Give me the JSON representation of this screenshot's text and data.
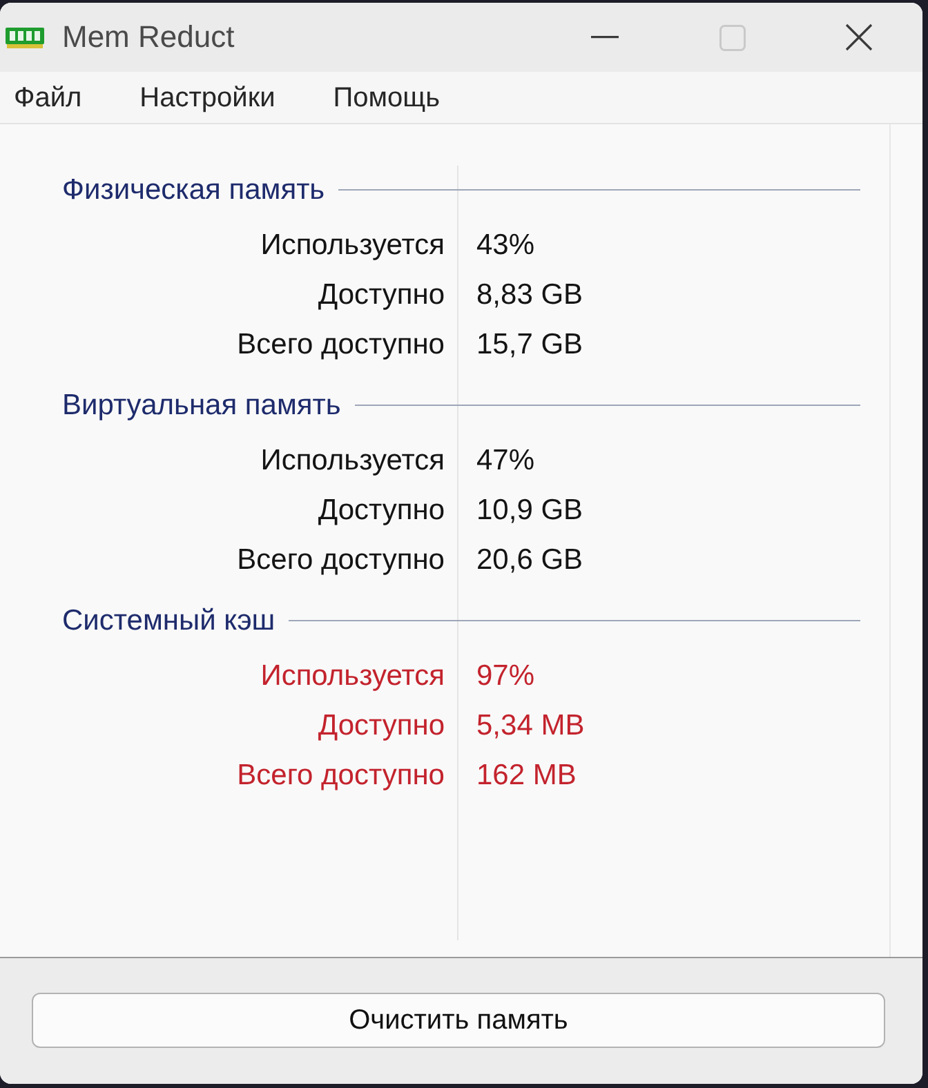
{
  "window": {
    "title": "Mem Reduct",
    "controls": [
      {
        "kind": "minimize",
        "disabled": false
      },
      {
        "kind": "maximize",
        "disabled": true
      },
      {
        "kind": "close",
        "disabled": false
      }
    ]
  },
  "menu": [
    "Файл",
    "Настройки",
    "Помощь"
  ],
  "groups": [
    {
      "title": "Физическая память",
      "rows": [
        {
          "label": "Используется",
          "value": "43%",
          "warning": false
        },
        {
          "label": "Доступно",
          "value": "8,83 GB",
          "warning": false
        },
        {
          "label": "Всего доступно",
          "value": "15,7 GB",
          "warning": false
        }
      ]
    },
    {
      "title": "Виртуальная память",
      "rows": [
        {
          "label": "Используется",
          "value": "47%",
          "warning": false
        },
        {
          "label": "Доступно",
          "value": "10,9 GB",
          "warning": false
        },
        {
          "label": "Всего доступно",
          "value": "20,6 GB",
          "warning": false
        }
      ]
    },
    {
      "title": "Системный кэш",
      "rows": [
        {
          "label": "Используется",
          "value": "97%",
          "warning": true
        },
        {
          "label": "Доступно",
          "value": "5,34 MB",
          "warning": true
        },
        {
          "label": "Всего доступно",
          "value": "162 MB",
          "warning": true
        }
      ]
    }
  ],
  "action_button": "Очистить память"
}
